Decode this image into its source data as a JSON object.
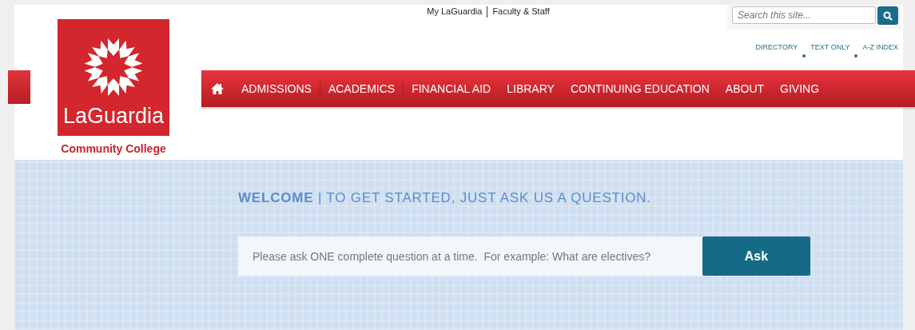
{
  "logo": {
    "name": "LaGuardia",
    "subtitle": "Community College"
  },
  "top_links": [
    "My LaGuardia",
    "Faculty & Staff"
  ],
  "search": {
    "placeholder": "Search this site..."
  },
  "utility_links": [
    "DIRECTORY",
    "TEXT ONLY",
    "A-Z INDEX"
  ],
  "nav": [
    "ADMISSIONS",
    "ACADEMICS",
    "FINANCIAL AID",
    "LIBRARY",
    "CONTINUING EDUCATION",
    "ABOUT",
    "GIVING"
  ],
  "welcome": {
    "heading": "**WELCOME** | TO GET STARTED, JUST ASK US A QUESTION."
  },
  "ask": {
    "placeholder": "Please ask ONE complete question at a time.  For example: What are electives?",
    "button": "Ask"
  }
}
